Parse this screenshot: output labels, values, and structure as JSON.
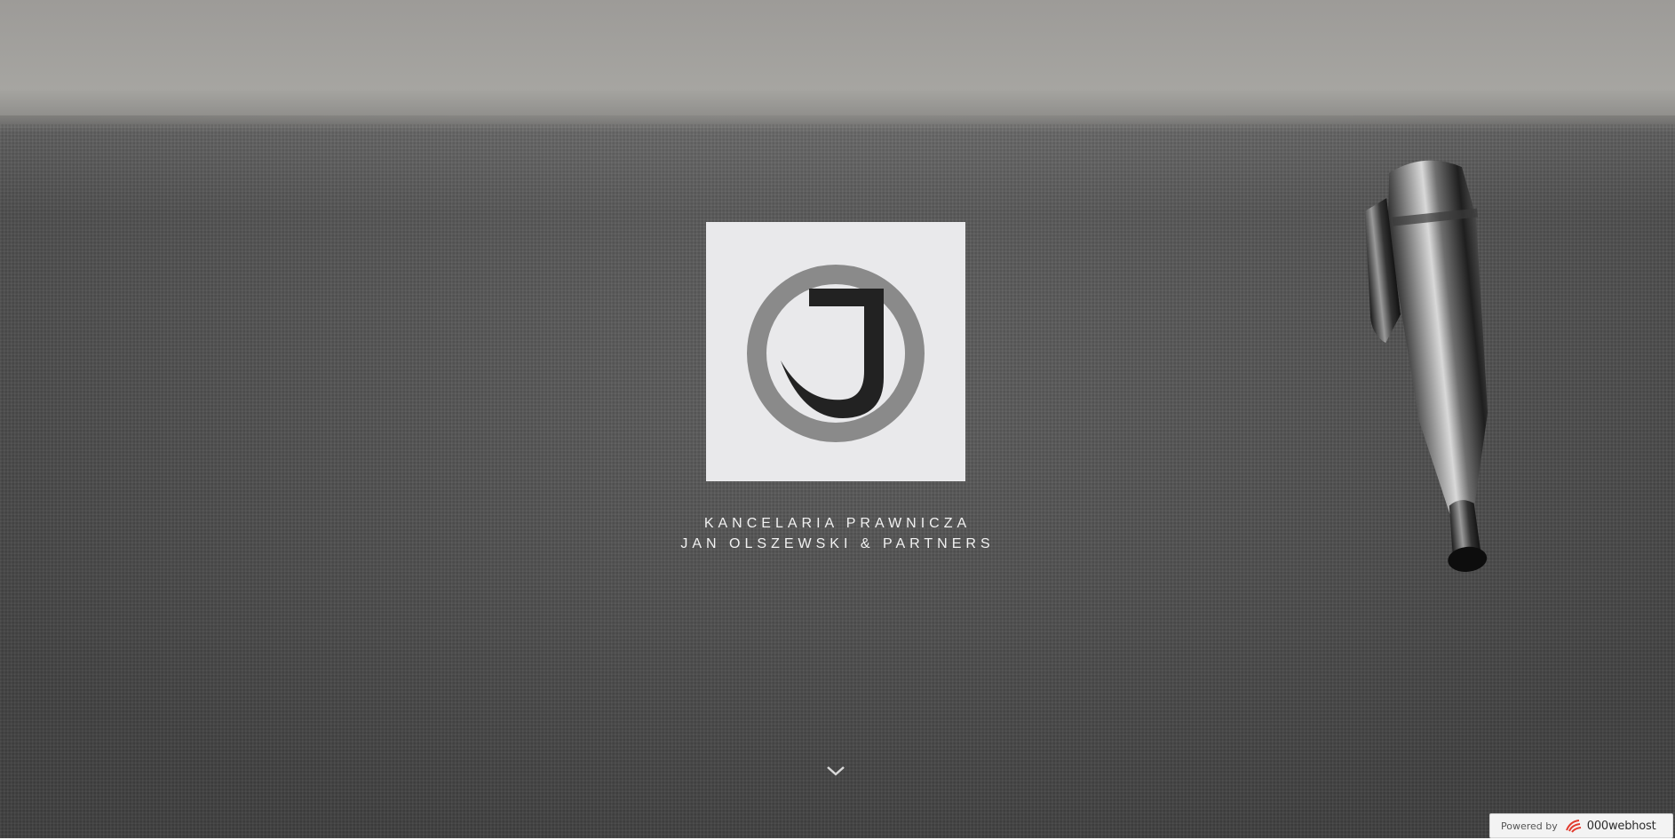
{
  "hero": {
    "brand_line1": "KANCELARIA PRAWNICZA",
    "brand_line2": "JAN OLSZEWSKI & PARTNERS"
  },
  "logo": {
    "letter": "J",
    "ring_color": "#8a8a8a",
    "letter_color": "#222222",
    "background_color": "#e9e9eb"
  },
  "scroll_indicator": {
    "icon": "chevron-down-icon"
  },
  "badge": {
    "powered_by": "Powered by",
    "host_name": "000webhost",
    "icon": "000webhost-logo-icon"
  }
}
